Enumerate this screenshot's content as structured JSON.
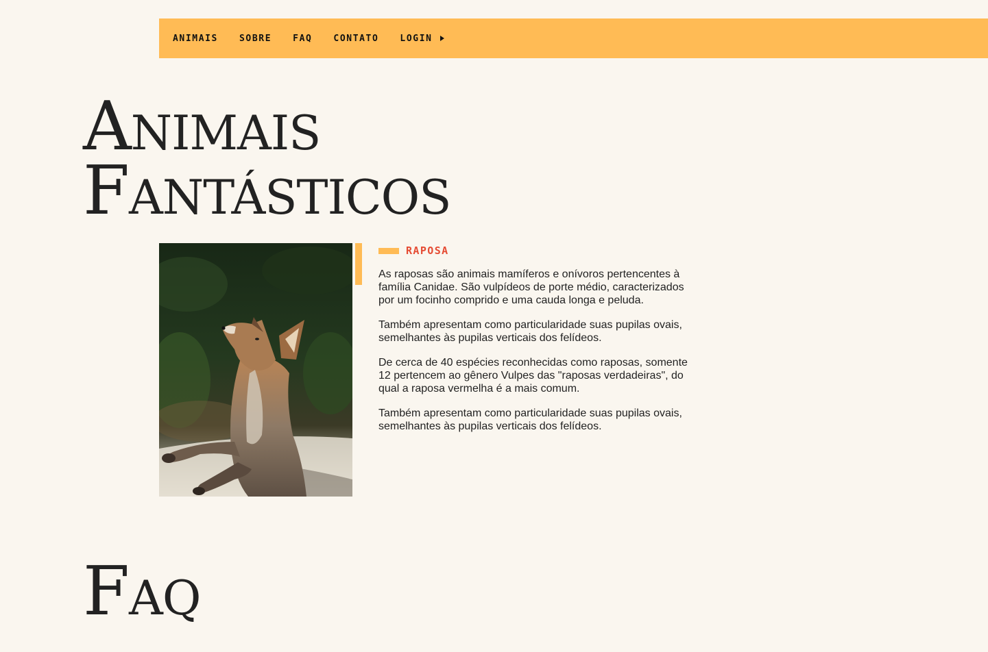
{
  "menu": {
    "items": [
      {
        "label": "ANIMAIS"
      },
      {
        "label": "SOBRE"
      },
      {
        "label": "FAQ"
      },
      {
        "label": "CONTATO"
      },
      {
        "label": "LOGIN",
        "icon": "arrow-right-icon"
      }
    ]
  },
  "title": {
    "line1": "Animais",
    "line2": "Fantásticos"
  },
  "animal": {
    "name": "RAPOSA",
    "photo_icon": "fox-photo",
    "paragraphs": [
      "As raposas são animais mamíferos e onívoros pertencentes à família Canidae. São vulpídeos de porte médio, caracterizados por um focinho comprido e uma cauda longa e peluda.",
      "Também apresentam como particularidade suas pupilas ovais, semelhantes às pupilas verticais dos felídeos.",
      "De cerca de 40 espécies reconhecidas como raposas, somente 12 pertencem ao gênero Vulpes das \"raposas verdadeiras\", do qual a raposa vermelha é a mais comum.",
      "Também apresentam como particularidade suas pupilas ovais, semelhantes às pupilas verticais dos felídeos."
    ]
  },
  "faq": {
    "title": "Faq"
  },
  "colors": {
    "background": "#FAF6EF",
    "accent": "#FFBB55",
    "highlight": "#E54B33",
    "text": "#222222"
  }
}
